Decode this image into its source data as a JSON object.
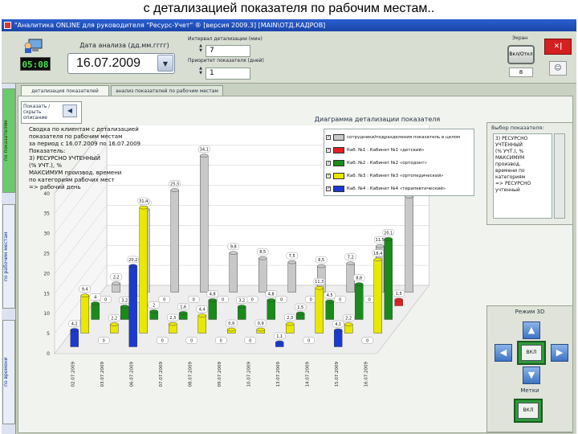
{
  "caption": "с детализацией показателя по рабочим местам..",
  "window": {
    "title": "\"Аналитика ONLINE для руководителя \"Ресурс-Учет\" ® [версия 2009.3]   [MAIN\\ОТД.КАДРОВ]"
  },
  "header": {
    "clock": "05:08",
    "date_label": "Дата анализа (дд.мм.гггг)",
    "date_value": "16.07.2009",
    "spin1_label": "Интервал детализации (мин)",
    "spin1_value": "7",
    "spin2_label": "Приоритет показателя (дней)",
    "spin2_value": "1",
    "screen_label": "Экран",
    "screen_button": "Вкл/Откл",
    "screen_value": "8",
    "exit_icon": "exit-icon",
    "help_icon": "help-icon"
  },
  "sidebar_tabs": [
    {
      "label": "по показателям",
      "active": true
    },
    {
      "label": "по рабочим местам",
      "active": false
    },
    {
      "label": "по времени",
      "active": false
    }
  ],
  "tabs": [
    {
      "label": "детализация показателей",
      "active": true
    },
    {
      "label": "анализ показателей по рабочим местам",
      "active": false
    }
  ],
  "collapse_panel": {
    "text": "Показать / скрыть описание",
    "button_icon": "arrow-left-icon"
  },
  "chart_title": "Диаграмма детализации показателя",
  "chart_description": [
    "Сводка по клиентам с детализацией",
    "показателя по рабочим местам",
    "за период с 16.07.2009 по 16.07.2009",
    "Показатель:",
    "3) РЕСУРСНО УЧТЕННЫЙ",
    "(% УЧТ.), %",
    "МАКСИМУМ производ. времени",
    "по категориям рабочих мест",
    "=> рабочий день"
  ],
  "legend": [
    {
      "label": "сотрудники/подразделения показатель в целом",
      "color": "#c8c8c8",
      "checked": true
    },
    {
      "label": "Каб. №1 : Кабинет №1 «детский»",
      "color": "#e02020",
      "checked": true
    },
    {
      "label": "Каб. №2 : Кабинет №2 «ортодонт»",
      "color": "#1a8a1a",
      "checked": true
    },
    {
      "label": "Каб. №3 : Кабинет №3 «ортопедический»",
      "color": "#e8e800",
      "checked": true
    },
    {
      "label": "Каб. №4 : Кабинет №4 «терапевтический»",
      "color": "#1a3ad0",
      "checked": true
    }
  ],
  "indicator_panel": {
    "title": "Выбор показателя:",
    "items": [
      "3) РЕСУРСНО",
      "УЧТЕННЫЙ",
      "(% УЧТ.), %",
      "МАКСИМУМ производ.",
      "времени по",
      "категориям",
      "=> РЕСУРСНО",
      "учтенный"
    ]
  },
  "mode_panel": {
    "title": "Режим 3D",
    "center_button": "ВКЛ",
    "labels_title": "Метки",
    "labels_button": "ВКЛ"
  },
  "chart_data": {
    "type": "bar",
    "categories": [
      "02.07.2009",
      "03.07.2009",
      "06.07.2009",
      "07.07.2009",
      "08.07.2009",
      "09.07.2009",
      "10.07.2009",
      "13.07.2009",
      "14.07.2009",
      "15.07.2009",
      "16.07.2009"
    ],
    "ylim": [
      0,
      40
    ],
    "yticks": [
      0,
      5,
      10,
      15,
      20,
      25,
      30,
      35,
      40
    ],
    "series": [
      {
        "name": "сотрудники/подразделения показатель в целом",
        "color": "#c8c8c8",
        "values": [
          2.2,
          20.7,
          25.5,
          34.1,
          9.8,
          8.5,
          7.5,
          6.5,
          7.2,
          11.5,
          23.9
        ]
      },
      {
        "name": "Каб. №1 : Кабинет №1 «детский»",
        "color": "#e02020",
        "values": [
          0,
          0,
          0,
          0,
          0,
          0,
          0,
          0,
          0,
          0,
          1.5
        ]
      },
      {
        "name": "Каб. №2 : Кабинет №2 «ортодонт»",
        "color": "#1a8a1a",
        "values": [
          4,
          3.2,
          2,
          1.6,
          4.8,
          3.2,
          4.8,
          1.5,
          4.5,
          8.8,
          20.1
        ]
      },
      {
        "name": "Каб. №3 : Кабинет №3 «ортопедический»",
        "color": "#e8e800",
        "values": [
          9.4,
          2.2,
          31.4,
          2.3,
          4.4,
          0.9,
          0.9,
          2.3,
          11.3,
          2.2,
          18.4
        ]
      },
      {
        "name": "Каб. №4 : Кабинет №4 «терапевтический»",
        "color": "#1a3ad0",
        "values": [
          4.2,
          0,
          20.2,
          0,
          0,
          0,
          0,
          1.1,
          0,
          4.1,
          0
        ]
      }
    ]
  }
}
